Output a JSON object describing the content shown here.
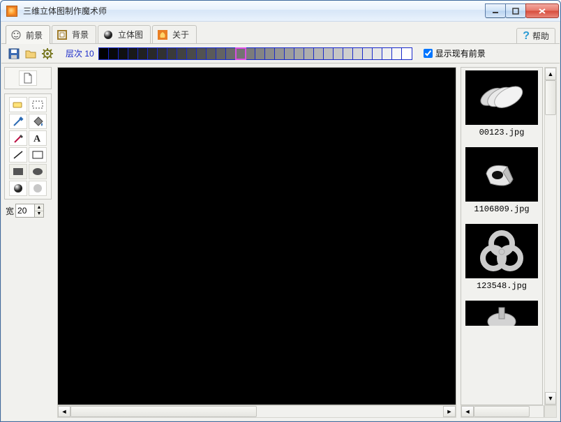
{
  "window": {
    "title": "三维立体图制作魔术师"
  },
  "tabs": {
    "foreground": "前景",
    "background": "背景",
    "stereo": "立体图",
    "about": "关于"
  },
  "help_label": "帮助",
  "layer": {
    "label": "层次 10",
    "cell_count": 32,
    "selected_index": 14
  },
  "checkbox": {
    "label": "显示现有前景",
    "checked": true
  },
  "width_row": {
    "label": "宽",
    "value": "20"
  },
  "tools": {
    "new": "new-icon",
    "erase": "eraser-icon",
    "select": "selection-icon",
    "pick": "picker-icon",
    "fill": "fill-icon",
    "pencil": "pencil-icon",
    "text": "text-icon",
    "line": "line-icon",
    "rect": "rect-icon",
    "rectfill": "rect-filled-icon",
    "ellipsefill": "ellipse-filled-icon",
    "ellipse": "ellipse-icon",
    "ellipsegray": "ellipse-gray-icon"
  },
  "thumbnails": [
    {
      "label": "00123.jpg"
    },
    {
      "label": "1106809.jpg"
    },
    {
      "label": "123548.jpg"
    },
    {
      "label": ""
    }
  ]
}
